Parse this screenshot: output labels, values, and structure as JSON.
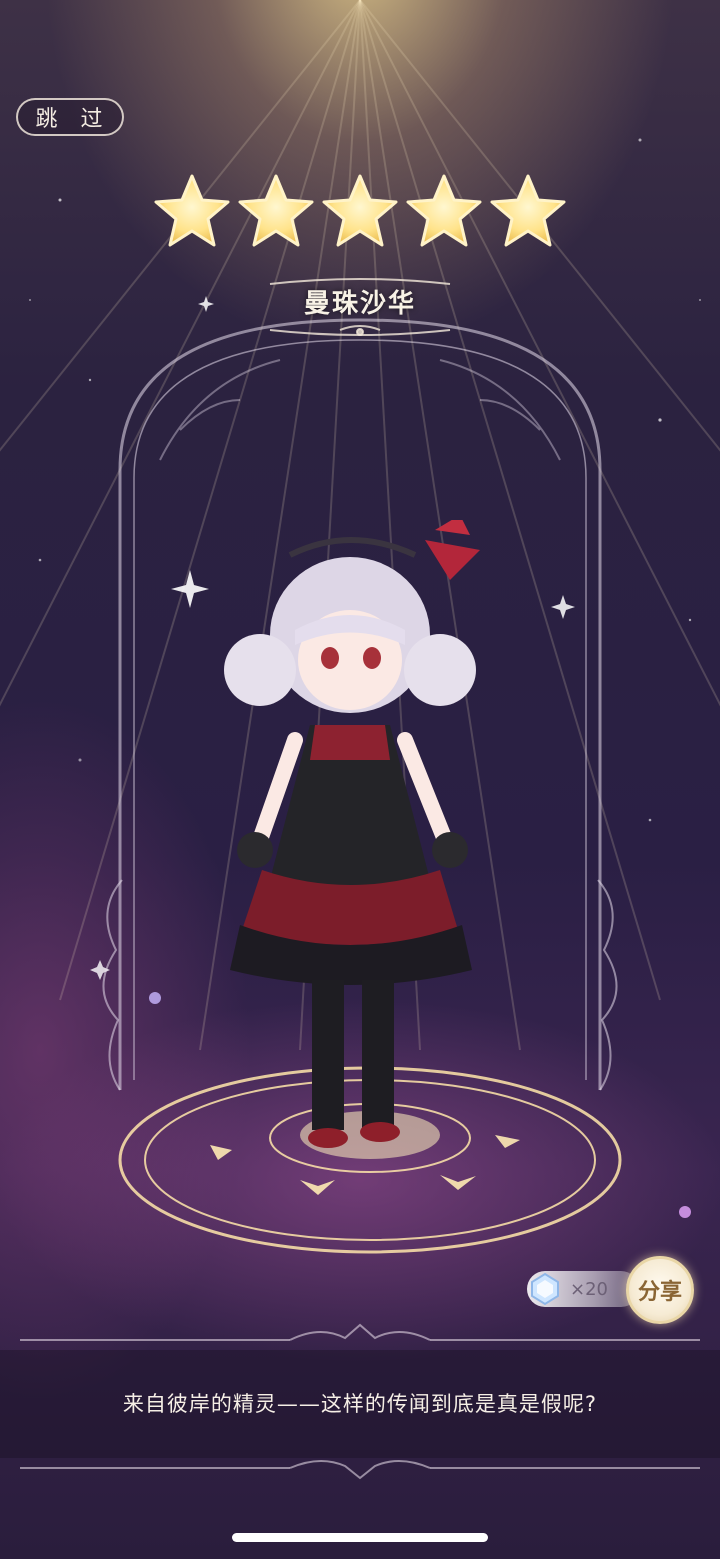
{
  "header": {
    "skip_label": "跳 过"
  },
  "rarity": {
    "stars": 5,
    "star_color": "#ffe79a"
  },
  "character": {
    "name": "曼珠沙华"
  },
  "reward": {
    "icon": "crystal-gem-icon",
    "count_label": "×20"
  },
  "actions": {
    "share_label": "分享"
  },
  "dialogue": {
    "caption": "来自彼岸的精灵——这样的传闻到底是真是假呢?"
  },
  "colors": {
    "accent_gold": "#e9d6a6",
    "background": "#2a1f44"
  }
}
